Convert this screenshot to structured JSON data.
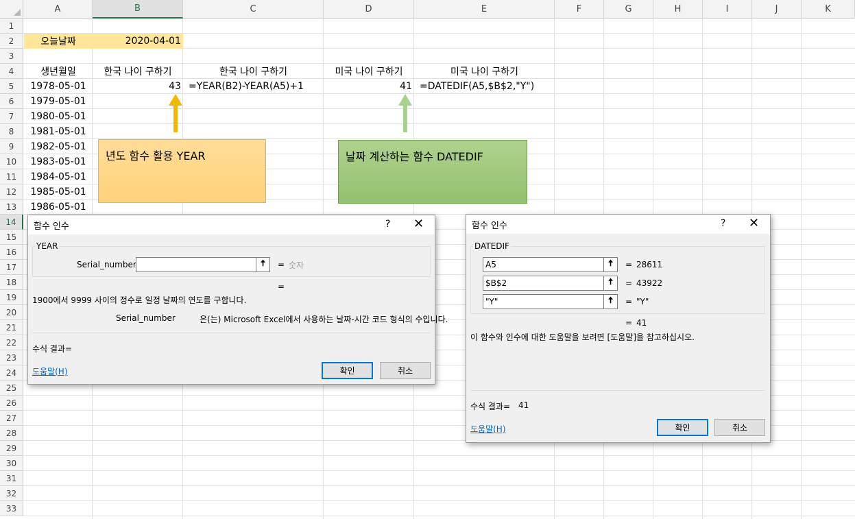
{
  "columns": [
    "A",
    "B",
    "C",
    "D",
    "E",
    "F",
    "G",
    "H",
    "I",
    "J",
    "K"
  ],
  "rows": [
    "1",
    "2",
    "3",
    "4",
    "5",
    "6",
    "7",
    "8",
    "9",
    "10",
    "11",
    "12",
    "13",
    "14",
    "15",
    "16",
    "17",
    "18",
    "19",
    "20",
    "21",
    "22",
    "23",
    "24",
    "25",
    "26",
    "27",
    "28",
    "29",
    "30",
    "31",
    "32",
    "33"
  ],
  "cells": {
    "a2": "오늘날짜",
    "b2": "2020-04-01",
    "a4": "생년월일",
    "b4": "한국 나이 구하기",
    "c4": "한국 나이 구하기",
    "d4": "미국 나이 구하기",
    "e4": "미국 나이 구하기",
    "a5": "1978-05-01",
    "b5": "43",
    "c5": "=YEAR(B2)-YEAR(A5)+1",
    "d5": "41",
    "e5": "=DATEDIF(A5,$B$2,\"Y\")",
    "a6": "1979-05-01",
    "a7": "1980-05-01",
    "a8": "1981-05-01",
    "a9": "1982-05-01",
    "a10": "1983-05-01",
    "a11": "1984-05-01",
    "a12": "1985-05-01",
    "a13": "1986-05-01"
  },
  "notes": {
    "orange": "년도 함수 활용 YEAR",
    "green": "날짜 계산하는 함수 DATEDIF"
  },
  "colors": {
    "header_selected": "#217346",
    "cell_fill": "#ffe699",
    "note_orange": "#ffd98e",
    "note_green": "#a9cd89",
    "arrow_orange": "#f5b800",
    "arrow_green": "#a9d18e",
    "link": "#0066cc"
  },
  "dialog_year": {
    "title": "함수 인수",
    "help": "?",
    "close": "✕",
    "function_name": "YEAR",
    "arg_label": "Serial_number",
    "arg_value": "",
    "eq": "=",
    "arg_result": "숫자",
    "result_eq": "=",
    "description": "1900에서 9999 사이의 정수로 일정 날짜의 연도를 구합니다.",
    "arg_help_label": "Serial_number",
    "arg_help": "은(는) Microsoft Excel에서 사용하는 날짜-시간 코드 형식의 수입니다.",
    "formula_result": "수식 결과=",
    "help_link": "도움말(H)",
    "ok": "확인",
    "cancel": "취소"
  },
  "dialog_datedif": {
    "title": "함수 인수",
    "help": "?",
    "close": "✕",
    "function_name": "DATEDIF",
    "args": [
      {
        "value": "A5",
        "eq": "=",
        "result": "28611"
      },
      {
        "value": "$B$2",
        "eq": "=",
        "result": "43922"
      },
      {
        "value": "\"Y\"",
        "eq": "=",
        "result": "\"Y\""
      }
    ],
    "result_eq": "=",
    "result": "41",
    "description": "이 함수와 인수에 대한 도움말을 보려면 [도움말]을 참고하십시오.",
    "formula_result_label": "수식 결과=",
    "formula_result": "41",
    "help_link": "도움말(H)",
    "ok": "확인",
    "cancel": "취소"
  }
}
